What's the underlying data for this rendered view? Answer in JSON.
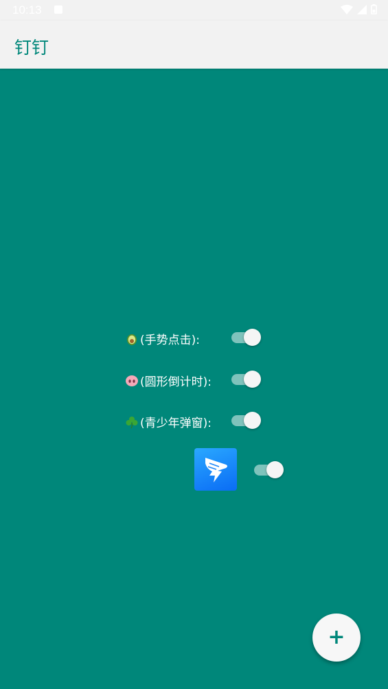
{
  "status_bar": {
    "time": "10:13",
    "icons": [
      "notification-icon",
      "wifi-icon",
      "signal-icon",
      "battery-icon"
    ]
  },
  "app_bar": {
    "title": "钉钉"
  },
  "settings": [
    {
      "label": "(手势点击):",
      "emoji": "avocado-icon",
      "enabled": true
    },
    {
      "label": "(圆形倒计时):",
      "emoji": "pig-nose-icon",
      "enabled": true
    },
    {
      "label": "(青少年弹窗):",
      "emoji": "shamrock-icon",
      "enabled": true
    }
  ],
  "app_toggle": {
    "app_icon": "dingtalk-logo-icon",
    "enabled": true
  },
  "fab": {
    "label": "+"
  },
  "colors": {
    "background": "#00877a",
    "app_bar": "#f2f2f2",
    "accent": "#00877a",
    "toggle_track": "#7fc3bc"
  }
}
